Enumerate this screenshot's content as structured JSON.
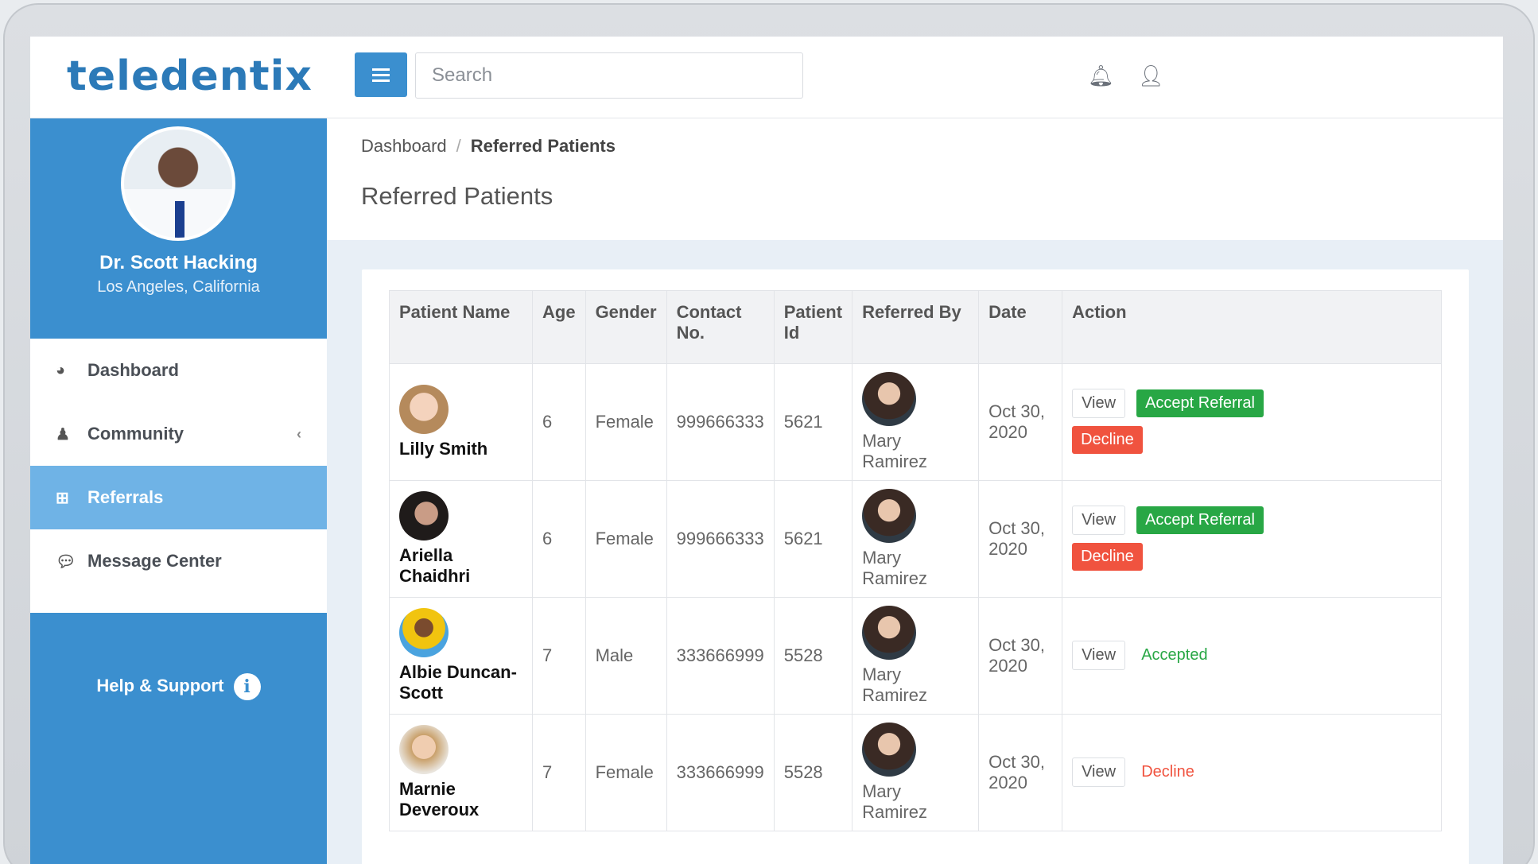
{
  "app": {
    "logo": "teledentix",
    "search_placeholder": "Search"
  },
  "profile": {
    "name": "Dr. Scott Hacking",
    "location": "Los Angeles, California"
  },
  "sidebar": {
    "items": [
      {
        "label": "Dashboard",
        "icon": "dashboard-icon"
      },
      {
        "label": "Community",
        "icon": "user-icon"
      },
      {
        "label": "Referrals",
        "icon": "plus-square-icon"
      },
      {
        "label": "Message Center",
        "icon": "comments-icon"
      }
    ],
    "help_label": "Help & Support"
  },
  "breadcrumb": {
    "home": "Dashboard",
    "separator": "/",
    "current": "Referred Patients"
  },
  "page_title": "Referred Patients",
  "table": {
    "headers": [
      "Patient Name",
      "Age",
      "Gender",
      "Contact No.",
      "Patient Id",
      "Referred By",
      "Date",
      "Action"
    ],
    "rows": [
      {
        "name": "Lilly Smith",
        "age": "6",
        "gender": "Female",
        "contact": "999666333",
        "id": "5621",
        "referred_by": "Mary Ramirez",
        "date": "Oct 30, 2020",
        "view": "View",
        "accept": "Accept Referral",
        "decline": "Decline",
        "status": ""
      },
      {
        "name": "Ariella Chaidhri",
        "age": "6",
        "gender": "Female",
        "contact": "999666333",
        "id": "5621",
        "referred_by": "Mary Ramirez",
        "date": "Oct 30, 2020",
        "view": "View",
        "accept": "Accept Referral",
        "decline": "Decline",
        "status": ""
      },
      {
        "name": "Albie Duncan-Scott",
        "age": "7",
        "gender": "Male",
        "contact": "333666999",
        "id": "5528",
        "referred_by": "Mary Ramirez",
        "date": "Oct 30, 2020",
        "view": "View",
        "accept": "",
        "decline": "",
        "status": "Accepted"
      },
      {
        "name": "Marnie Deveroux",
        "age": "7",
        "gender": "Female",
        "contact": "333666999",
        "id": "5528",
        "referred_by": "Mary Ramirez",
        "date": "Oct 30, 2020",
        "view": "View",
        "accept": "",
        "decline": "",
        "status": "Decline"
      }
    ]
  },
  "colors": {
    "primary": "#3b8fcf",
    "active_nav": "#6fb3e6",
    "accept": "#28a745",
    "decline": "#f0533f"
  }
}
